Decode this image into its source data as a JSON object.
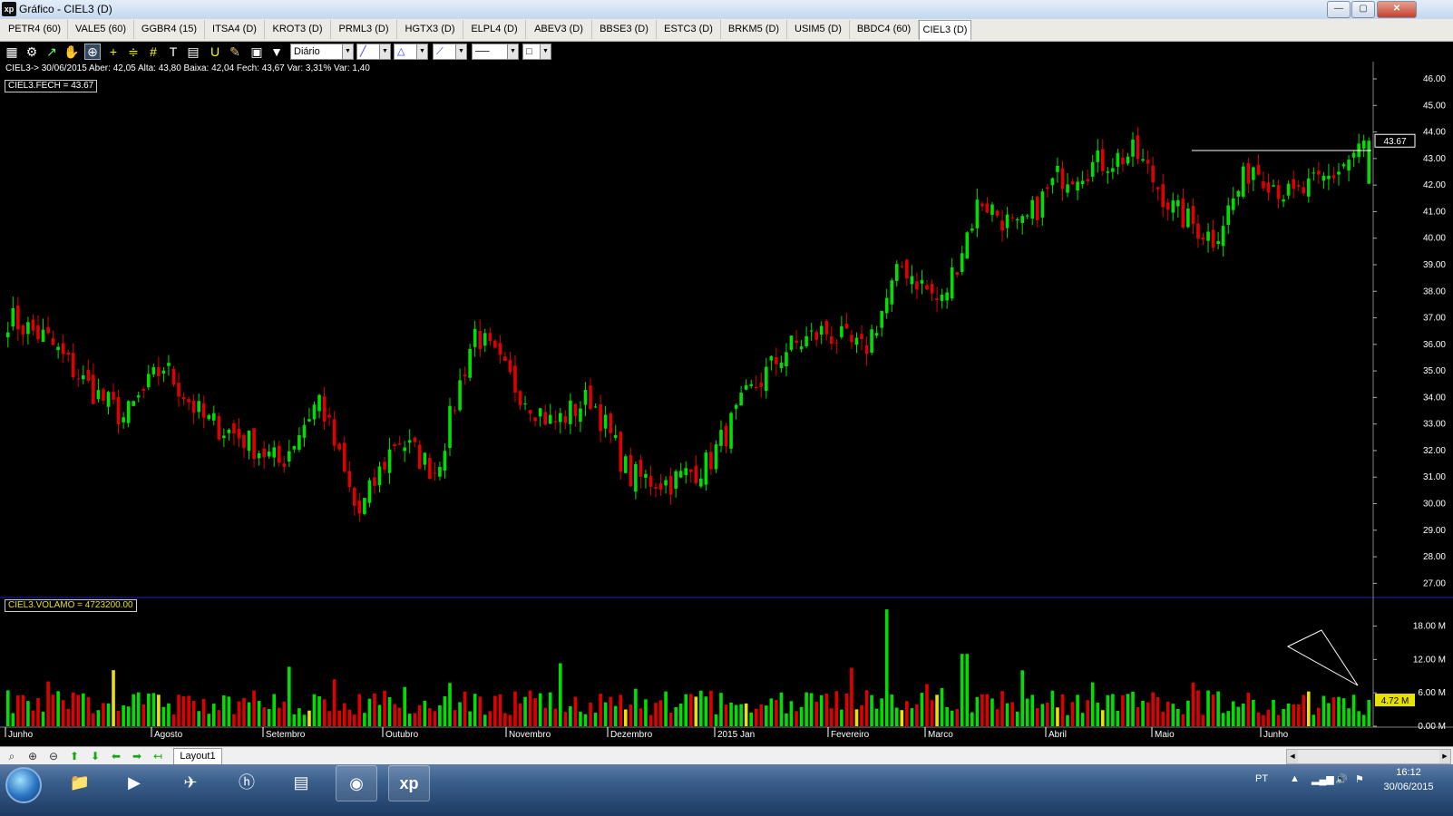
{
  "window": {
    "title": "Gráfico - CIEL3 (D)",
    "app_badge": "xp"
  },
  "tabs": [
    "PETR4 (60)",
    "VALE5 (60)",
    "GGBR4 (15)",
    "ITSA4 (D)",
    "KROT3 (D)",
    "PRML3 (D)",
    "HGTX3 (D)",
    "ELPL4 (D)",
    "ABEV3 (D)",
    "BBSE3 (D)",
    "ESTC3 (D)",
    "BRKM5 (D)",
    "USIM5 (D)",
    "BBDC4 (60)",
    "CIEL3 (D)"
  ],
  "active_tab": "CIEL3 (D)",
  "toolbar": {
    "period": "Diário"
  },
  "quote": {
    "text": "CIEL3-> 30/06/2015 Aber: 42,05 Alta: 43,80 Baixa: 42,04 Fech: 43,67 Var: 3,31% Var: 1,40"
  },
  "price_legend": "CIEL3.FECH = 43.67",
  "volume_legend": "CIEL3.VOLAMO = 4723200.00",
  "last_price_label": "43.67",
  "last_volume_label": "4.72 M",
  "colors": {
    "up": "#00e000",
    "down": "#e00000",
    "neutral": "#f0e000",
    "background": "#000000",
    "grid_text": "#ffffff"
  },
  "chart_data": {
    "type": "candlestick",
    "ylim": [
      26.5,
      46.0
    ],
    "y_ticks": [
      "46.00",
      "45.00",
      "44.00",
      "43.00",
      "42.00",
      "41.00",
      "40.00",
      "39.00",
      "38.00",
      "37.00",
      "36.00",
      "35.00",
      "34.00",
      "33.00",
      "32.00",
      "31.00",
      "30.00",
      "29.00",
      "28.00",
      "27.00"
    ],
    "volume_ticks": [
      "18.00 M",
      "12.00 M",
      "6.00 M",
      "0.00 M"
    ],
    "volume_ylim": [
      0,
      22
    ],
    "months": [
      "Junho",
      "Agosto",
      "Setembro",
      "Outubro",
      "Novembro",
      "Dezembro",
      "2015 Jan",
      "Fevereiro",
      "Marco",
      "Abril",
      "Maio",
      "Junho"
    ],
    "resistance_level": 43.3,
    "key_closes": [
      37.0,
      36.2,
      34.5,
      33.2,
      35.2,
      33.2,
      32.5,
      31.5,
      34.0,
      29.5,
      32.5,
      31.2,
      36.5,
      34.5,
      33.0,
      34.0,
      31.0,
      30.8,
      31.5,
      34.0,
      35.8,
      36.5,
      35.7,
      39.0,
      37.5,
      41.5,
      40.2,
      42.3,
      42.8,
      43.2,
      41.0,
      40.0,
      42.8,
      41.5,
      42.3,
      43.67
    ]
  }
}
